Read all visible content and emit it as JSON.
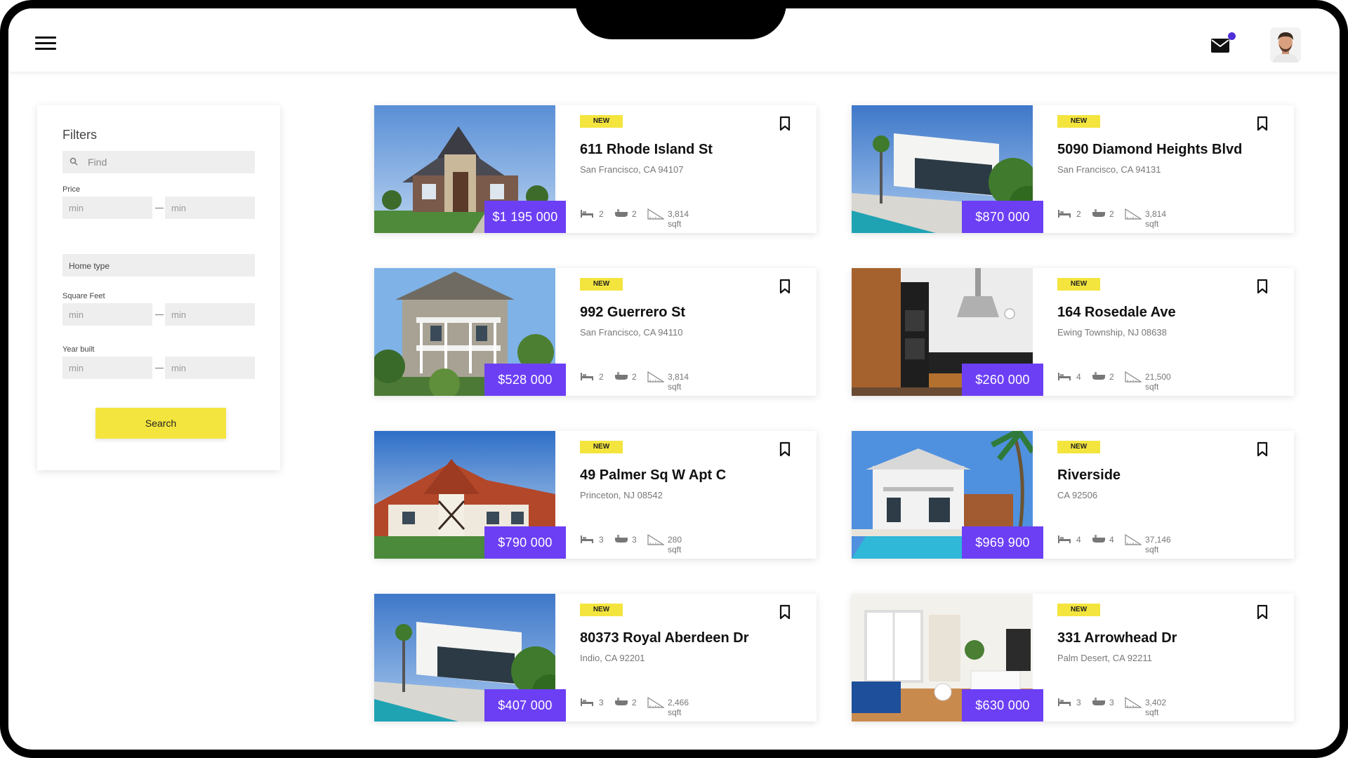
{
  "filters": {
    "title": "Filters",
    "find_placeholder": "Find",
    "price_label": "Price",
    "price_min_placeholder": "min",
    "price_max_placeholder": "min",
    "home_type_label": "Home type",
    "sqft_label": "Square Feet",
    "sqft_min_placeholder": "min",
    "sqft_max_placeholder": "min",
    "year_label": "Year built",
    "year_min_placeholder": "min",
    "year_max_placeholder": "min",
    "search_label": "Search"
  },
  "colors": {
    "accent": "#6c3ff5",
    "badge": "#f4e53e",
    "notification_dot": "#4f2fd9"
  },
  "listings": [
    {
      "badge": "NEW",
      "price": "$1 195 000",
      "address": "611 Rhode Island St",
      "city": "San Francisco, CA 94107",
      "beds": "2",
      "baths": "2",
      "area": "3,814 sqft",
      "image": "brick-house"
    },
    {
      "badge": "NEW",
      "price": "$870 000",
      "address": "5090 Diamond Heights Blvd",
      "city": "San Francisco, CA 94131",
      "beds": "2",
      "baths": "2",
      "area": "3,814 sqft",
      "image": "modern-villa"
    },
    {
      "badge": "NEW",
      "price": "$528 000",
      "address": "992 Guerrero St",
      "city": "San Francisco, CA 94110",
      "beds": "2",
      "baths": "2",
      "area": "3,814 sqft",
      "image": "victorian-house"
    },
    {
      "badge": "NEW",
      "price": "$260 000",
      "address": "164 Rosedale Ave",
      "city": "Ewing Township, NJ 08638",
      "beds": "4",
      "baths": "2",
      "area": "21,500 sqft",
      "image": "kitchen"
    },
    {
      "badge": "NEW",
      "price": "$790 000",
      "address": "49 Palmer Sq W Apt C",
      "city": "Princeton, NJ 08542",
      "beds": "3",
      "baths": "3",
      "area": "280 sqft",
      "image": "tudor-house"
    },
    {
      "badge": "NEW",
      "price": "$969 900",
      "address": "Riverside",
      "city": "CA 92506",
      "beds": "4",
      "baths": "4",
      "area": "37,146 sqft",
      "image": "pool-house"
    },
    {
      "badge": "NEW",
      "price": "$407 000",
      "address": "80373 Royal Aberdeen Dr",
      "city": "Indio, CA 92201",
      "beds": "3",
      "baths": "2",
      "area": "2,466 sqft",
      "image": "modern-villa"
    },
    {
      "badge": "NEW",
      "price": "$630 000",
      "address": "331 Arrowhead Dr",
      "city": "Palm Desert, CA 92211",
      "beds": "3",
      "baths": "3",
      "area": "3,402 sqft",
      "image": "living-room"
    }
  ]
}
